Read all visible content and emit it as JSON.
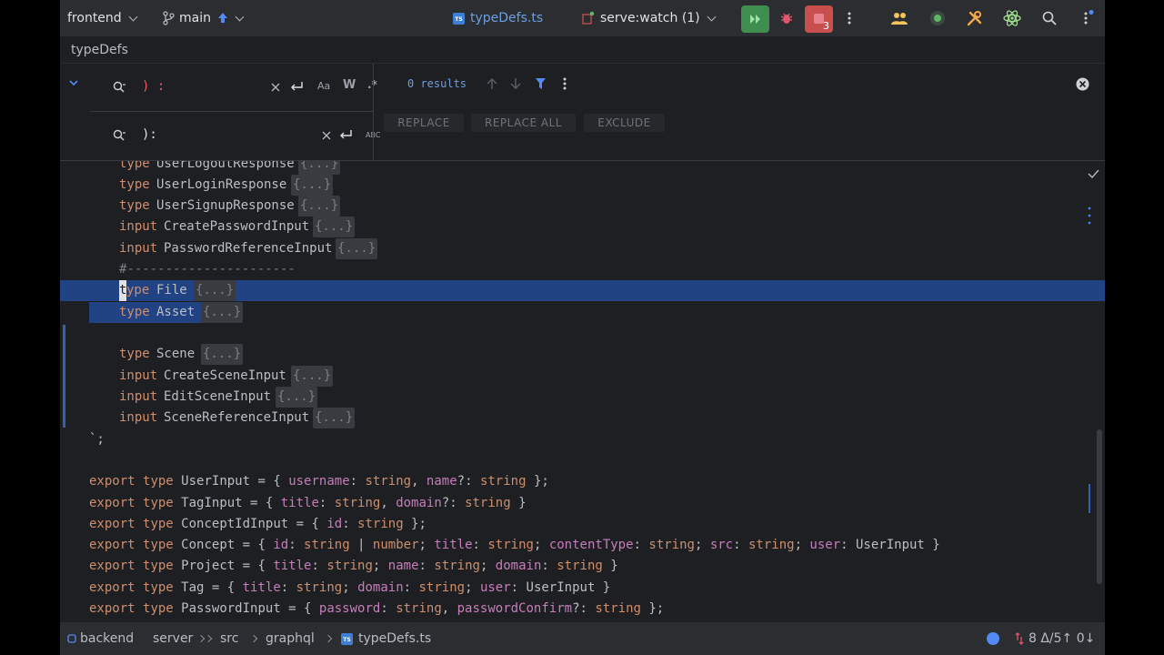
{
  "toolbar": {
    "project": "frontend",
    "branch": "main",
    "open_file": "typeDefs.ts",
    "run_config": "serve:watch (1)",
    "notifications_count": "3",
    "ts_badge": "TS"
  },
  "file_header": {
    "title": "typeDefs"
  },
  "find": {
    "search_value": ") :",
    "replace_value": "):",
    "results": "0 results",
    "opt_case": "Aa",
    "opt_words": "W",
    "opt_regex": ".*",
    "opt_preserve_case": "ABC",
    "replace_label": "REPLACE",
    "replace_all_label": "REPLACE ALL",
    "exclude_label": "EXCLUDE"
  },
  "code": {
    "l0_kw": "type",
    "l0_name": "UserLogoutResponse",
    "l1_kw": "type",
    "l1_name": "UserLoginResponse",
    "l2_kw": "type",
    "l2_name": "UserSignupResponse",
    "l3_kw": "input",
    "l3_name": "CreatePasswordInput",
    "l4_kw": "input",
    "l4_name": "PasswordReferenceInput",
    "l5_comment": "#----------------------",
    "l6_cursor": "t",
    "l6_kw": "ype",
    "l6_name": "File",
    "l7_kw": "type",
    "l7_name": "Asset",
    "l9_kw": "type",
    "l9_name": "Scene",
    "l10_kw": "input",
    "l10_name": "CreateSceneInput",
    "l11_kw": "input",
    "l11_name": "EditSceneInput",
    "l12_kw": "input",
    "l12_name": "SceneReferenceInput",
    "fold": "{...}",
    "l13_text": "`;",
    "export_kw": "export",
    "type_kw": "type",
    "string_kw": "string",
    "l15_a": "UserInput = { ",
    "l15_p1": "username",
    "l15_b": ": ",
    "l15_c": ", ",
    "l15_p2": "name",
    "l15_d": "?: ",
    "l15_e": " };",
    "l16_a": "TagInput = { ",
    "l16_p1": "title",
    "l16_b": ": ",
    "l16_c": ", ",
    "l16_p2": "domain",
    "l16_d": "?: ",
    "l16_e": " }",
    "l17_a": "ConceptIdInput = { ",
    "l17_p1": "id",
    "l17_b": ": ",
    "l17_e": " };",
    "l18_a": "Concept = { ",
    "l18_p1": "id",
    "l18_b": ": ",
    "l18_c": " | ",
    "l18_n": "number",
    "l18_d": "; ",
    "l18_p2": "title",
    "l18_p3": "contentType",
    "l18_p4": "src",
    "l18_p5": "user",
    "l18_e": ": UserInput }",
    "l19_a": "Project = { ",
    "l19_p1": "title",
    "l19_p2": "name",
    "l19_p3": "domain",
    "l19_e": " }",
    "l20_a": "Tag = { ",
    "l20_p1": "title",
    "l20_p2": "domain",
    "l20_p3": "user",
    "l20_e": ": UserInput }",
    "l21_a": "PasswordInput = { ",
    "l21_p1": "password",
    "l21_p2": "passwordConfirm",
    "l21_e": " };",
    "colon": ": ",
    "semi": "; ",
    "comma": ", ",
    "qcolon": "?: "
  },
  "statusbar": {
    "crumbs": [
      "backend",
      "server",
      "src",
      "graphql",
      "typeDefs.ts"
    ],
    "vcs_info": "8 Δ/5↑ 0↓"
  },
  "colors": {
    "keyword": "#cf8e6d",
    "property": "#c77dbb",
    "selection": "#214283",
    "run_green": "#3e8f4f",
    "notify_red": "#c94f4f"
  },
  "icons": [
    "branch-icon",
    "push-arrow-icon",
    "ts-file-icon",
    "run-config-icon",
    "run-icon",
    "debug-icon",
    "notifications-icon",
    "more-icon",
    "collaborators-icon",
    "status-icon",
    "build-tools-icon",
    "ai-atom-icon",
    "search-icon",
    "settings-more-icon",
    "expand-chevron-icon",
    "search-field-icon",
    "clear-icon",
    "newline-icon",
    "prev-occurrence-icon",
    "next-occurrence-icon",
    "filter-icon",
    "close-icon",
    "check-icon",
    "module-icon",
    "vcs-icon"
  ]
}
